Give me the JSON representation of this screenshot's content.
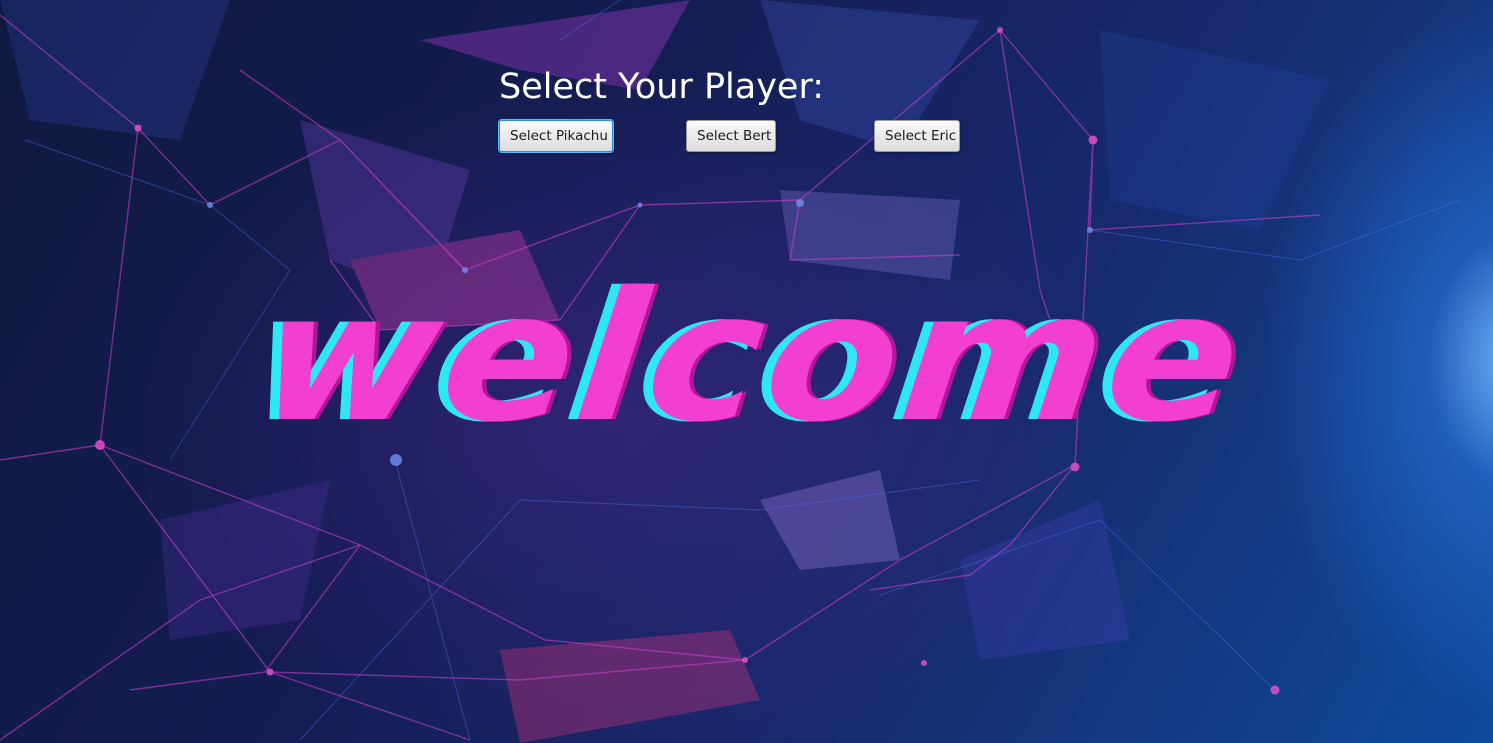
{
  "screen": {
    "prompt": "Select Your Player:",
    "welcome_text": "welcome"
  },
  "buttons": [
    {
      "label": "Select Pikachu",
      "focused": true
    },
    {
      "label": "Select Bert",
      "focused": false
    },
    {
      "label": "Select Eric",
      "focused": false
    }
  ],
  "colors": {
    "welcome_fill": "#f23fd2",
    "welcome_offset": "#2de8f0",
    "network_lines": "#d23fd0",
    "focus_ring": "#2b90e0"
  }
}
